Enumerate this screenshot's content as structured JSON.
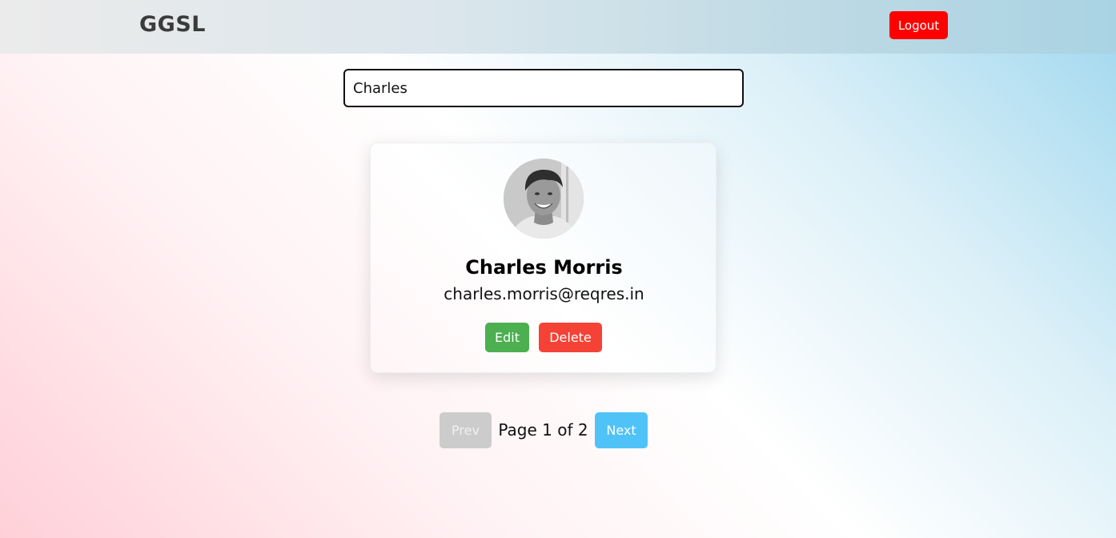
{
  "header": {
    "brand": "GGSL",
    "logout_label": "Logout"
  },
  "search": {
    "value": "Charles"
  },
  "user_card": {
    "name": "Charles Morris",
    "email": "charles.morris@reqres.in",
    "edit_label": "Edit",
    "delete_label": "Delete"
  },
  "pagination": {
    "prev_label": "Prev",
    "next_label": "Next",
    "page_info": "Page 1 of 2",
    "prev_disabled": true
  },
  "colors": {
    "logout": "#ff0000",
    "edit": "#4caf50",
    "delete": "#f44336",
    "next": "#4fc3f7",
    "prev_disabled": "#cccccc"
  }
}
